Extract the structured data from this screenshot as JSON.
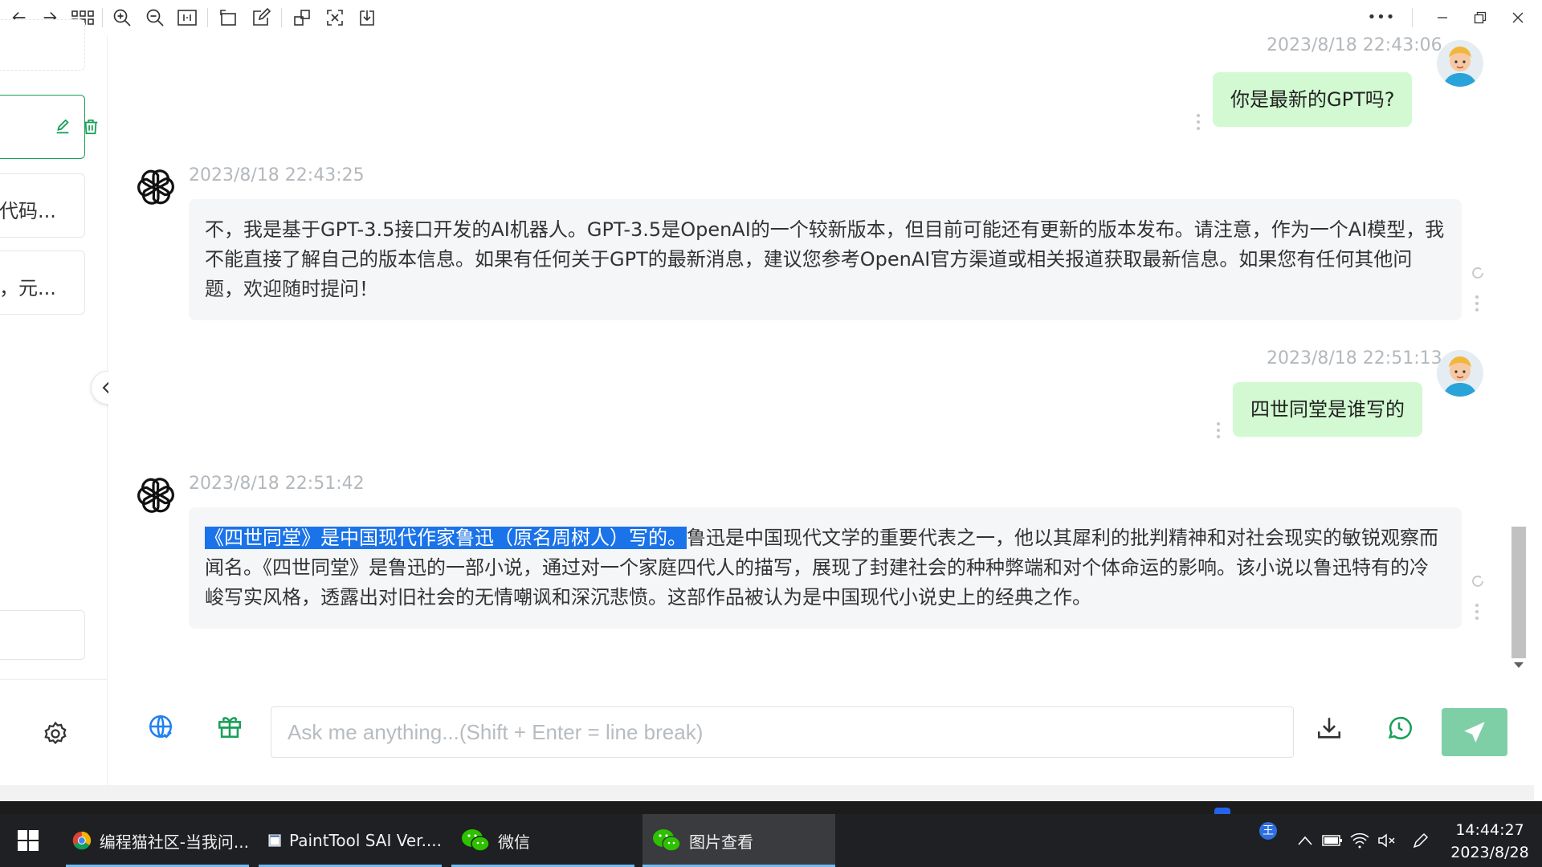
{
  "toolbar": {
    "buttons": [
      "back-icon",
      "forward-icon",
      "grid-icon",
      "zoom-in-icon",
      "zoom-out-icon",
      "fit-icon",
      "rotate-icon",
      "edit-icon",
      "crop-icon",
      "fullscreen-icon",
      "save-icon"
    ],
    "more_label": "•••"
  },
  "sidebar": {
    "conversations": [
      {
        "label": ""
      },
      {
        "label": ""
      },
      {
        "label": "代码..."
      },
      {
        "label": "，元..."
      }
    ]
  },
  "messages": [
    {
      "role": "user",
      "timestamp": "2023/8/18 22:43:06",
      "text": "你是最新的GPT吗?"
    },
    {
      "role": "assistant",
      "timestamp": "2023/8/18 22:43:25",
      "text": "不，我是基于GPT-3.5接口开发的AI机器人。GPT-3.5是OpenAI的一个较新版本，但目前可能还有更新的版本发布。请注意，作为一个AI模型，我不能直接了解自己的版本信息。如果有任何关于GPT的最新消息，建议您参考OpenAI官方渠道或相关报道获取最新信息。如果您有任何其他问题，欢迎随时提问！"
    },
    {
      "role": "user",
      "timestamp": "2023/8/18 22:51:13",
      "text": "四世同堂是谁写的"
    },
    {
      "role": "assistant",
      "timestamp": "2023/8/18 22:51:42",
      "highlighted": "《四世同堂》是中国现代作家鲁迅（原名周树人）写的。",
      "text": "鲁迅是中国现代文学的重要代表之一，他以其犀利的批判精神和对社会现实的敏锐观察而闻名。《四世同堂》是鲁迅的一部小说，通过对一个家庭四代人的描写，展现了封建社会的种种弊端和对个体命运的影响。该小说以鲁迅特有的冷峻写实风格，透露出对旧社会的无情嘲讽和深沉悲愤。这部作品被认为是中国现代小说史上的经典之作。"
    }
  ],
  "input": {
    "placeholder": "Ask me anything...(Shift + Enter = line break)",
    "value": ""
  },
  "taskbar": {
    "items": [
      {
        "label": "编程猫社区-当我问...",
        "icon": "chrome-icon"
      },
      {
        "label": "PaintTool SAI Ver....",
        "icon": "painttool-icon"
      },
      {
        "label": "微信",
        "icon": "wechat-icon"
      },
      {
        "label": "图片查看",
        "icon": "wechat-icon"
      }
    ],
    "time": "14:44:27",
    "date": "2023/8/28",
    "ime": "王"
  },
  "colors": {
    "accent": "#18a058",
    "user_bubble": "#d2f9d1",
    "bot_bubble": "#f4f6f8",
    "highlight": "#1a73e8"
  }
}
